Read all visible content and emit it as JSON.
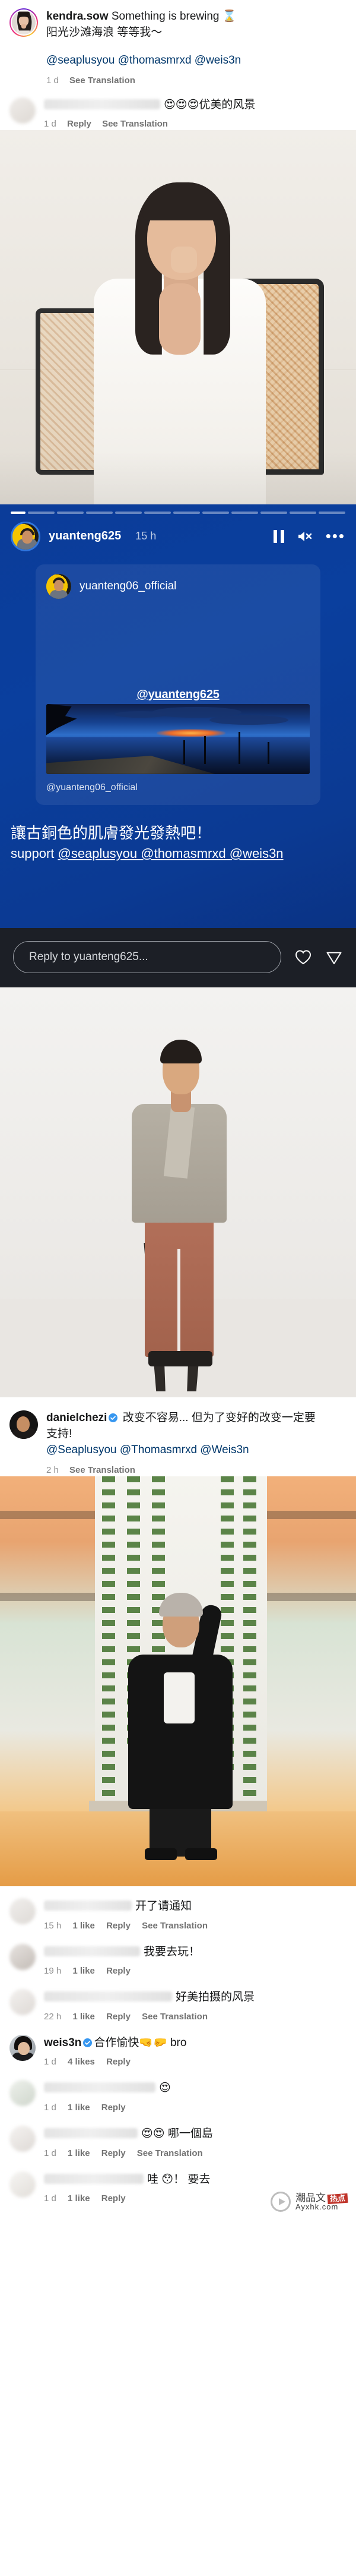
{
  "post1": {
    "username": "kendra.sow",
    "caption_line1": "Something is brewing ⌛",
    "caption_line2": "阳光沙滩海浪 等等我～",
    "mentions": "@seaplusyou @thomasmrxd @weis3n",
    "time": "1 d",
    "translate_label": "See Translation",
    "comment": {
      "text": "😍😍😍优美的风景",
      "time": "1 d",
      "reply_label": "Reply",
      "translate_label": "See Translation"
    }
  },
  "story": {
    "username": "yuanteng625",
    "time": "15 h",
    "segments_total": 12,
    "active_segment": 1,
    "pause_icon": "pause-icon",
    "mute_icon": "mute-icon",
    "more_icon": "more-options-icon",
    "card": {
      "account": "yuanteng06_official",
      "mention_label": "@yuanteng625",
      "attribution": "@yuanteng06_official"
    },
    "caption_line1": "讓古銅色的肌膚發光發熱吧！",
    "caption_line2_prefix": "support ",
    "caption_line2_mentions": "@seaplusyou @thomasmrxd @weis3n",
    "reply_placeholder": "Reply to yuanteng625...",
    "like_icon": "heart-icon",
    "send_icon": "send-icon",
    "bg_color": "#0b3c99",
    "bar_color": "#1c1f26"
  },
  "post3": {
    "username": "danielchezi",
    "verified": true,
    "caption_line1": "改变不容易... 但为了变好的改变一定要",
    "caption_line2": "支持!",
    "mentions": "@Seaplusyou @Thomasmrxd @Weis3n",
    "time": "2 h",
    "translate_label": "See Translation"
  },
  "comments": [
    {
      "name_hidden": true,
      "name_width": 148,
      "text": "开了请通知",
      "time": "15 h",
      "likes": "1 like",
      "reply_label": "Reply",
      "translate_label": "See Translation",
      "verified": false
    },
    {
      "name_hidden": true,
      "name_width": 162,
      "text": "我要去玩！",
      "time": "19 h",
      "likes": "1 like",
      "reply_label": "Reply",
      "translate_label": "",
      "verified": false
    },
    {
      "name_hidden": true,
      "name_width": 216,
      "text": "好美拍摄的风景",
      "time": "22 h",
      "likes": "1 like",
      "reply_label": "Reply",
      "translate_label": "See Translation",
      "verified": false
    },
    {
      "name_hidden": false,
      "name": "weis3n",
      "text": "合作愉快🤜🤛 bro",
      "time": "1 d",
      "likes": "4 likes",
      "reply_label": "Reply",
      "translate_label": "",
      "verified": true
    },
    {
      "name_hidden": true,
      "name_width": 188,
      "text": "😍",
      "time": "1 d",
      "likes": "1 like",
      "reply_label": "Reply",
      "translate_label": "",
      "verified": false
    },
    {
      "name_hidden": true,
      "name_width": 158,
      "text": "😍😍 哪一個島",
      "time": "1 d",
      "likes": "1 like",
      "reply_label": "Reply",
      "translate_label": "See Translation",
      "verified": false
    },
    {
      "name_hidden": true,
      "name_width": 168,
      "text": "哇 😯！ 要去",
      "time": "1 d",
      "likes": "1 like",
      "reply_label": "Reply",
      "translate_label": "",
      "verified": false
    }
  ],
  "watermark": {
    "line1": "潮品文",
    "badge": "热点",
    "line2": "Ayxhk.com",
    "play_icon": "play-icon"
  }
}
